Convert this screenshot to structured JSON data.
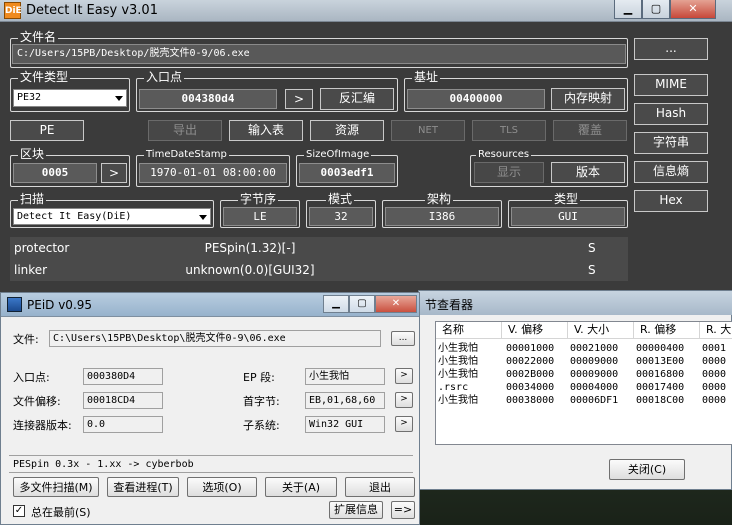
{
  "die": {
    "title": "Detect It Easy v3.01",
    "logo": "DiE",
    "filename_label": "文件名",
    "filename": "C:/Users/15PB/Desktop/脱壳文件0-9/06.exe",
    "browse": "...",
    "filetype_label": "文件类型",
    "filetype": "PE32",
    "entry_label": "入口点",
    "entry": "004380d4",
    "entry_go": ">",
    "disasm": "反汇编",
    "base_label": "基址",
    "base": "00400000",
    "memmap": "内存映射",
    "mime": "MIME",
    "hash": "Hash",
    "strings": "字符串",
    "entropy": "信息熵",
    "hex": "Hex",
    "pe": "PE",
    "export": "导出",
    "import": "输入表",
    "resources": "资源",
    "net": "NET",
    "tls": "TLS",
    "overlay": "覆盖",
    "sections_label": "区块",
    "sections": "0005",
    "sections_go": ">",
    "tds_label": "TimeDateStamp",
    "tds": "1970-01-01 08:00:00",
    "soi_label": "SizeOfImage",
    "soi": "0003edf1",
    "resources_label": "Resources",
    "show": "显示",
    "version": "版本",
    "scan_label": "扫描",
    "scan": "Detect It Easy(DiE)",
    "endian_label": "字节序",
    "endian": "LE",
    "mode_label": "模式",
    "mode": "32",
    "arch_label": "架构",
    "arch": "I386",
    "type_label": "类型",
    "type": "GUI",
    "results": [
      {
        "kind": "protector",
        "name": "PESpin(1.32)[-]",
        "flag": "S"
      },
      {
        "kind": "linker",
        "name": "unknown(0.0)[GUI32]",
        "flag": "S"
      }
    ]
  },
  "peid": {
    "title": "PEiD v0.95",
    "file_label": "文件:",
    "file": "C:\\Users\\15PB\\Desktop\\脱壳文件0-9\\06.exe",
    "browse": "...",
    "ep_label": "入口点:",
    "ep": "000380D4",
    "epsec_label": "EP 段:",
    "epsec": "小生我怕",
    "foff_label": "文件偏移:",
    "foff": "00018CD4",
    "fb_label": "首字节:",
    "fb": "EB,01,68,60",
    "lv_label": "连接器版本:",
    "lv": "0.0",
    "sub_label": "子系统:",
    "sub": "Win32 GUI",
    "arrow": ">",
    "result": "PESpin 0.3x - 1.xx -> cyberbob",
    "multi": "多文件扫描(M)",
    "tasks": "查看进程(T)",
    "options": "选项(O)",
    "about": "关于(A)",
    "exit": "退出",
    "ontop": "总在最前(S)",
    "plugins": "扩展信息",
    "menu": "=>"
  },
  "sections": {
    "title": "节查看器",
    "headers": [
      "名称",
      "V. 偏移",
      "V. 大小",
      "R. 偏移",
      "R. 大"
    ],
    "rows": [
      [
        "小生我怕",
        "00001000",
        "00021000",
        "00000400",
        "0001"
      ],
      [
        "小生我怕",
        "00022000",
        "00009000",
        "00013E00",
        "0000"
      ],
      [
        "小生我怕",
        "0002B000",
        "00009000",
        "00016800",
        "0000"
      ],
      [
        ".rsrc",
        "00034000",
        "00004000",
        "00017400",
        "0000"
      ],
      [
        "小生我怕",
        "00038000",
        "00006DF1",
        "00018C00",
        "0000"
      ]
    ],
    "close": "关闭(C)"
  }
}
